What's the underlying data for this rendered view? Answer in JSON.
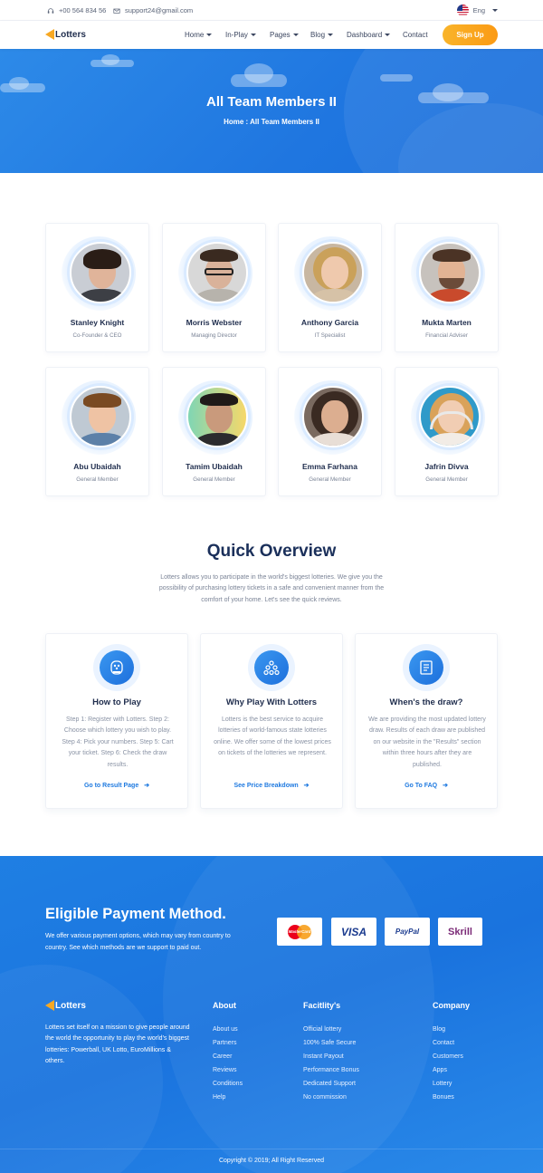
{
  "topbar": {
    "phone": "+00 564 834 56",
    "email": "support24@gmail.com",
    "language": "Eng"
  },
  "nav": {
    "logo": "Lotters",
    "items": [
      {
        "label": "Home",
        "dropdown": true
      },
      {
        "label": "In-Play",
        "dropdown": true
      },
      {
        "label": "Pages",
        "dropdown": true
      },
      {
        "label": "Blog",
        "dropdown": true
      },
      {
        "label": "Dashboard",
        "dropdown": true
      },
      {
        "label": "Contact",
        "dropdown": false
      }
    ],
    "signup": "Sign Up"
  },
  "hero": {
    "title": "All Team Members II",
    "breadcrumb": "Home : All Team Members II"
  },
  "team": [
    {
      "name": "Stanley Knight",
      "role": "Co-Founder & CEO"
    },
    {
      "name": "Morris Webster",
      "role": "Managing Director"
    },
    {
      "name": "Anthony Garcia",
      "role": "IT Specialist"
    },
    {
      "name": "Mukta Marten",
      "role": "Financial Adviser"
    },
    {
      "name": "Abu Ubaidah",
      "role": "General Member"
    },
    {
      "name": "Tamim Ubaidah",
      "role": "General Member"
    },
    {
      "name": "Emma Farhana",
      "role": "General Member"
    },
    {
      "name": "Jafrin Divva",
      "role": "General Member"
    }
  ],
  "overview": {
    "title": "Quick Overview",
    "text": "Lotters allows you to participate in the world's biggest lotteries. We give you the possibility of purchasing lottery tickets in a safe and convenient manner from the comfort of your home. Let's see the quick reviews.",
    "cards": [
      {
        "icon": "lottery-machine-icon",
        "title": "How to Play",
        "text": "Step 1: Register with Lotters. Step 2: Choose which lottery you wish to play. Step 4: Pick your numbers. Step 5: Cart your ticket. Step 6: Check the draw results.",
        "link": "Go to Result Page"
      },
      {
        "icon": "lottery-balls-icon",
        "title": "Why Play With Lotters",
        "text": "Lotters is the best service to acquire lotteries of world-famous state lotteries online. We offer some of the lowest prices on tickets of the lotteries we represent.",
        "link": "See Price Breakdown"
      },
      {
        "icon": "ticket-list-icon",
        "title": "When's the draw?",
        "text": "We are providing the most updated lottery draw. Results of each draw are published on our website in the \"Results\" section within three hours after they are published.",
        "link": "Go To FAQ"
      }
    ]
  },
  "payment": {
    "title": "Eligible Payment Method.",
    "text": "We offer various payment options, which may vary from country to country. See which methods are we support to paid out.",
    "methods": [
      "MasterCard",
      "VISA",
      "PayPal",
      "Skrill"
    ]
  },
  "footer": {
    "logo": "Lotters",
    "about_text": "Lotters set itself on a mission to give people around the world the opportunity to play the world's biggest lotteries: Powerball, UK Lotto, EuroMillions & others.",
    "columns": [
      {
        "title": "About",
        "links": [
          "About us",
          "Partners",
          "Career",
          "Reviews",
          "Conditions",
          "Help"
        ]
      },
      {
        "title": "Facitlity's",
        "links": [
          "Official lottery",
          "100% Safe Secure",
          "Instant Payout",
          "Performance Bonus",
          "Dedicated Support",
          "No commission"
        ]
      },
      {
        "title": "Company",
        "links": [
          "Blog",
          "Contact",
          "Customers",
          "Apps",
          "Lottery",
          "Bonues"
        ]
      }
    ],
    "copyright": "Copyright © 2019; All Right Reserved"
  },
  "colors": {
    "primary": "#1f7ae0",
    "accent": "#fba821",
    "heading": "#1f2d4d"
  }
}
